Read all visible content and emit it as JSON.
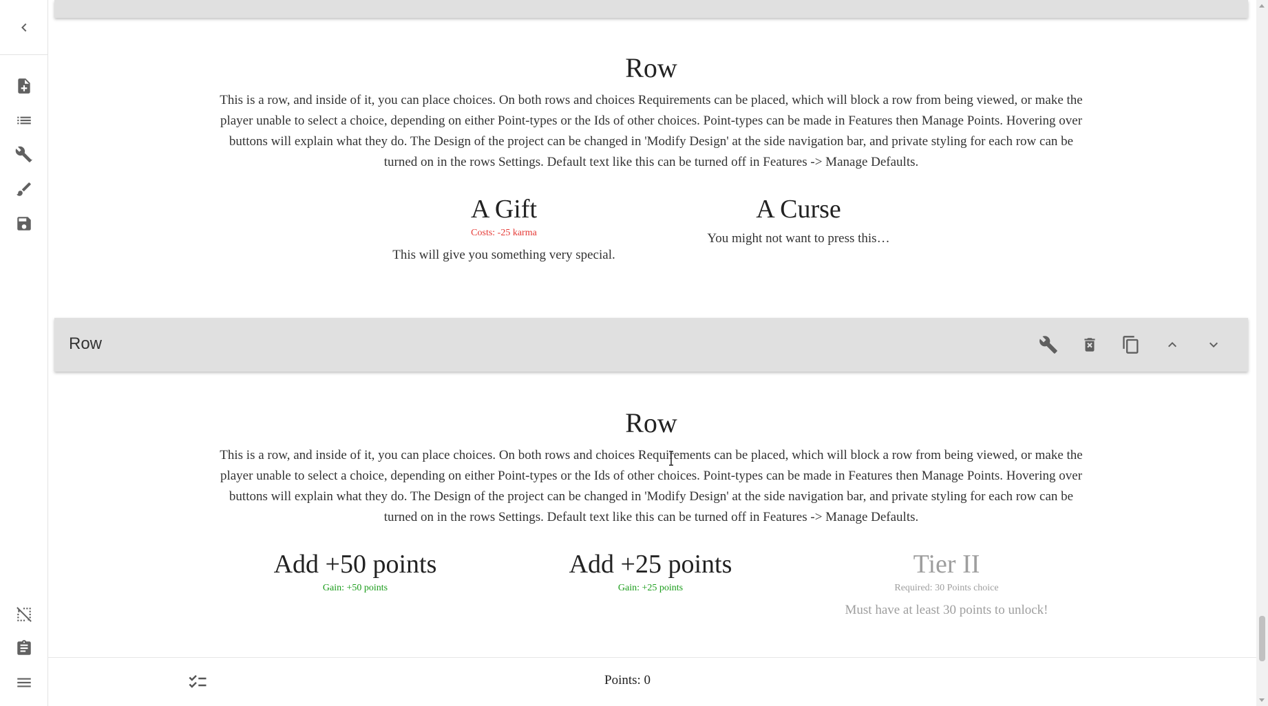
{
  "rail": {
    "icons": [
      "chevron-left-icon",
      "new-document-icon",
      "list-icon",
      "tools-icon",
      "brush-icon",
      "save-icon",
      "hide-selection-icon",
      "clipboard-icon",
      "menu-icon"
    ]
  },
  "toolbar_mid": {
    "label": "Row",
    "icons": [
      "wrench-icon",
      "delete-icon",
      "copy-icon",
      "chevron-up-icon",
      "chevron-down-icon"
    ]
  },
  "row1": {
    "title": "Row",
    "text": "This is a row, and inside of it, you can place choices. On both rows and choices Requirements can be placed, which will block a row from being viewed, or make the player unable to select a choice, depending on either Point-types or the Ids of other choices. Point-types can be made in Features then Manage Points. Hovering over buttons will explain what they do. The Design of the project can be changed in 'Modify Design' at the side navigation bar, and private styling for each row can be turned on in the rows Settings. Default text like this can be turned off in Features -> Manage Defaults.",
    "choices": [
      {
        "title": "A Gift",
        "score": "Costs: -25  karma",
        "desc": "This will give you something very special."
      },
      {
        "title": "A Curse",
        "score": "",
        "desc": "You might not want to press this…"
      }
    ]
  },
  "row2": {
    "title": "Row",
    "text": "This is a row, and inside of it, you can place choices. On both rows and choices Requirements can be placed, which will block a row from being viewed, or make the player unable to select a choice, depending on either Point-types or the Ids of other choices. Point-types can be made in Features then Manage Points. Hovering over buttons will explain what they do. The Design of the project can be changed in 'Modify Design' at the side navigation bar, and private styling for each row can be turned on in the rows Settings. Default text like this can be turned off in Features -> Manage Defaults.",
    "choices": [
      {
        "title": "Add +50 points",
        "score": "Gain: +50  points",
        "desc": ""
      },
      {
        "title": "Add +25 points",
        "score": "Gain: +25  points",
        "desc": ""
      },
      {
        "title": "Tier II",
        "score": "Required: 30 Points choice",
        "desc": "Must have at least 30 points to unlock!"
      }
    ]
  },
  "bottom_bar": {
    "points": "Points: 0"
  },
  "colors": {
    "cost": "#e53935",
    "gain": "#1a9c1a",
    "disabled": "#9e9e9e",
    "toolbar": "#e0e0e0"
  }
}
